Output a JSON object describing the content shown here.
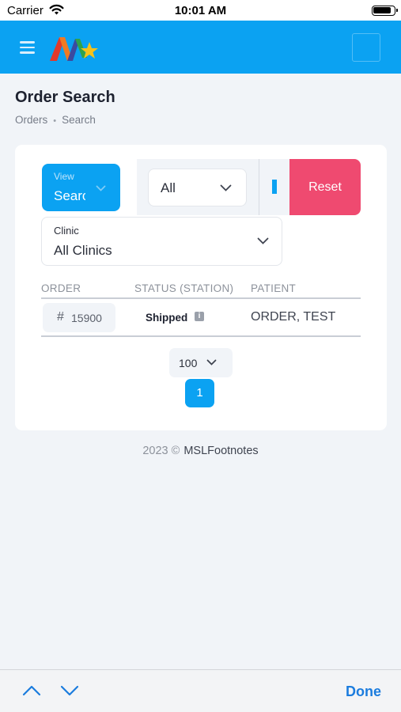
{
  "status_bar": {
    "carrier": "Carrier",
    "time": "10:01 AM"
  },
  "header": {
    "menu_icon": "hamburger-icon",
    "logo_icon": "brand-logo"
  },
  "page": {
    "title": "Order Search",
    "breadcrumb": [
      "Orders",
      "Search"
    ]
  },
  "filters": {
    "view": {
      "label": "View",
      "value": "Search"
    },
    "status": {
      "value": "All"
    },
    "reset_label": "Reset",
    "clinic": {
      "label": "Clinic",
      "value": "All Clinics"
    }
  },
  "table": {
    "columns": [
      "ORDER",
      "STATUS (STATION)",
      "PATIENT"
    ],
    "rows": [
      {
        "order": "15900",
        "status": "Shipped",
        "patient": "ORDER, TEST"
      }
    ]
  },
  "pagination": {
    "page_size": "100",
    "current_page": "1"
  },
  "footer": {
    "year": "2023 ©",
    "brand": "MSLFootnotes"
  },
  "toolbar": {
    "done_label": "Done"
  },
  "colors": {
    "primary": "#0ba2f2",
    "reset": "#ef4a70",
    "done": "#1b7cde",
    "background": "#f1f4f8"
  }
}
